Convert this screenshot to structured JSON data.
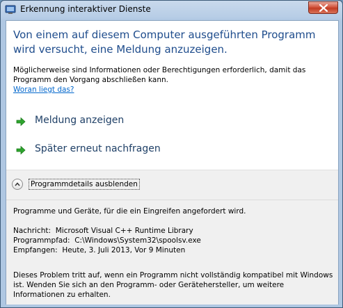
{
  "window": {
    "title": "Erkennung interaktiver Dienste"
  },
  "main": {
    "heading": "Von einem auf diesem Computer ausgeführten Programm wird versucht, eine Meldung anzuzeigen.",
    "description": "Möglicherweise sind Informationen oder Berechtigungen erforderlich, damit das Programm den Vorgang abschließen kann.",
    "link": "Woran liegt das?",
    "commands": [
      {
        "label": "Meldung anzeigen",
        "icon": "green-arrow-icon"
      },
      {
        "label": "Später erneut nachfragen",
        "icon": "green-arrow-icon"
      }
    ]
  },
  "details": {
    "toggle_label": "Programmdetails ausblenden",
    "toggle_icon": "chevron-up-icon",
    "intro": "Programme und Geräte, für die ein Eingreifen angefordert wird.",
    "message_label": "Nachricht:",
    "message_value": "Microsoft Visual C++ Runtime Library",
    "path_label": "Programmpfad:",
    "path_value": "C:\\Windows\\System32\\spoolsv.exe",
    "received_label": "Empfangen:",
    "received_value": "Heute, 3. Juli 2013, Vor 9 Minuten",
    "footer": "Dieses Problem tritt auf, wenn ein Programm nicht vollständig kompatibel mit Windows ist. Wenden Sie sich an den Programm- oder Gerätehersteller, um weitere Informationen zu erhalten."
  },
  "colors": {
    "heading": "#1e4c8c",
    "link": "#0066cc",
    "arrow": "#2ea52e",
    "close": "#c23c23"
  }
}
